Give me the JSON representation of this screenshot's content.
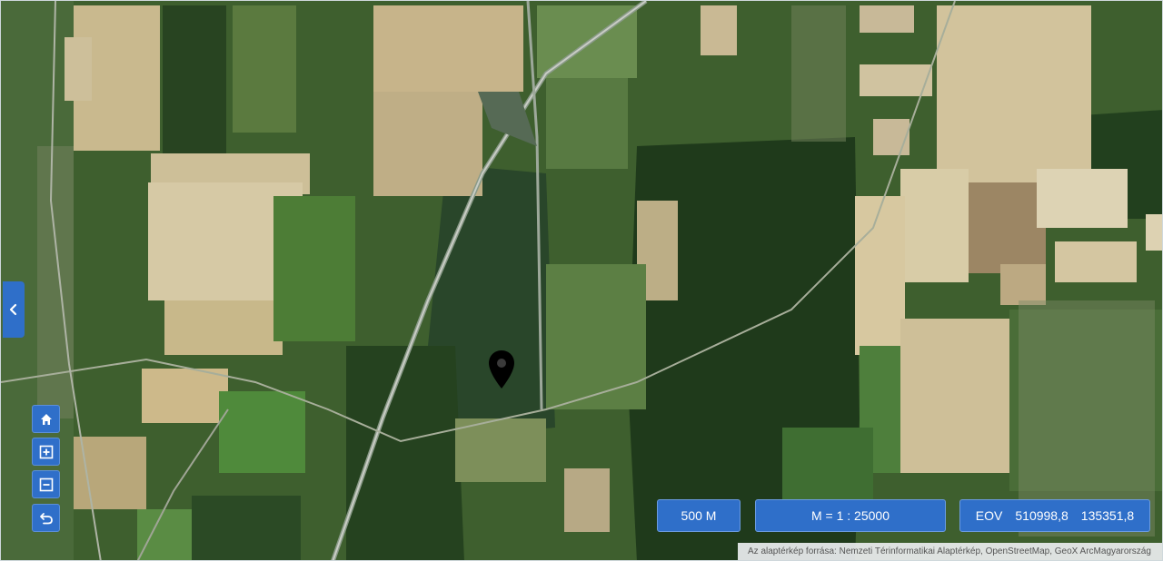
{
  "map": {
    "basemap": "satellite imagery",
    "marker_icon": "map-pin-icon"
  },
  "controls": {
    "collapse_icon": "chevron-left-icon",
    "home_icon": "home-icon",
    "zoom_in_icon": "zoom-in-icon",
    "zoom_out_icon": "zoom-out-icon",
    "back_icon": "undo-icon"
  },
  "status": {
    "scale_bar": "500 M",
    "scale_ratio": "M = 1 : 25000",
    "coord_system": "EOV",
    "coord_x": "510998,8",
    "coord_y": "135351,8"
  },
  "attribution": "Az alaptérkép forrása: Nemzeti Térinformatikai Alaptérkép, OpenStreetMap, GeoX ArcMagyarország",
  "colors": {
    "control_blue": "#2f6fc9",
    "forest": "#24401f",
    "field_light": "#d8c9a0"
  }
}
